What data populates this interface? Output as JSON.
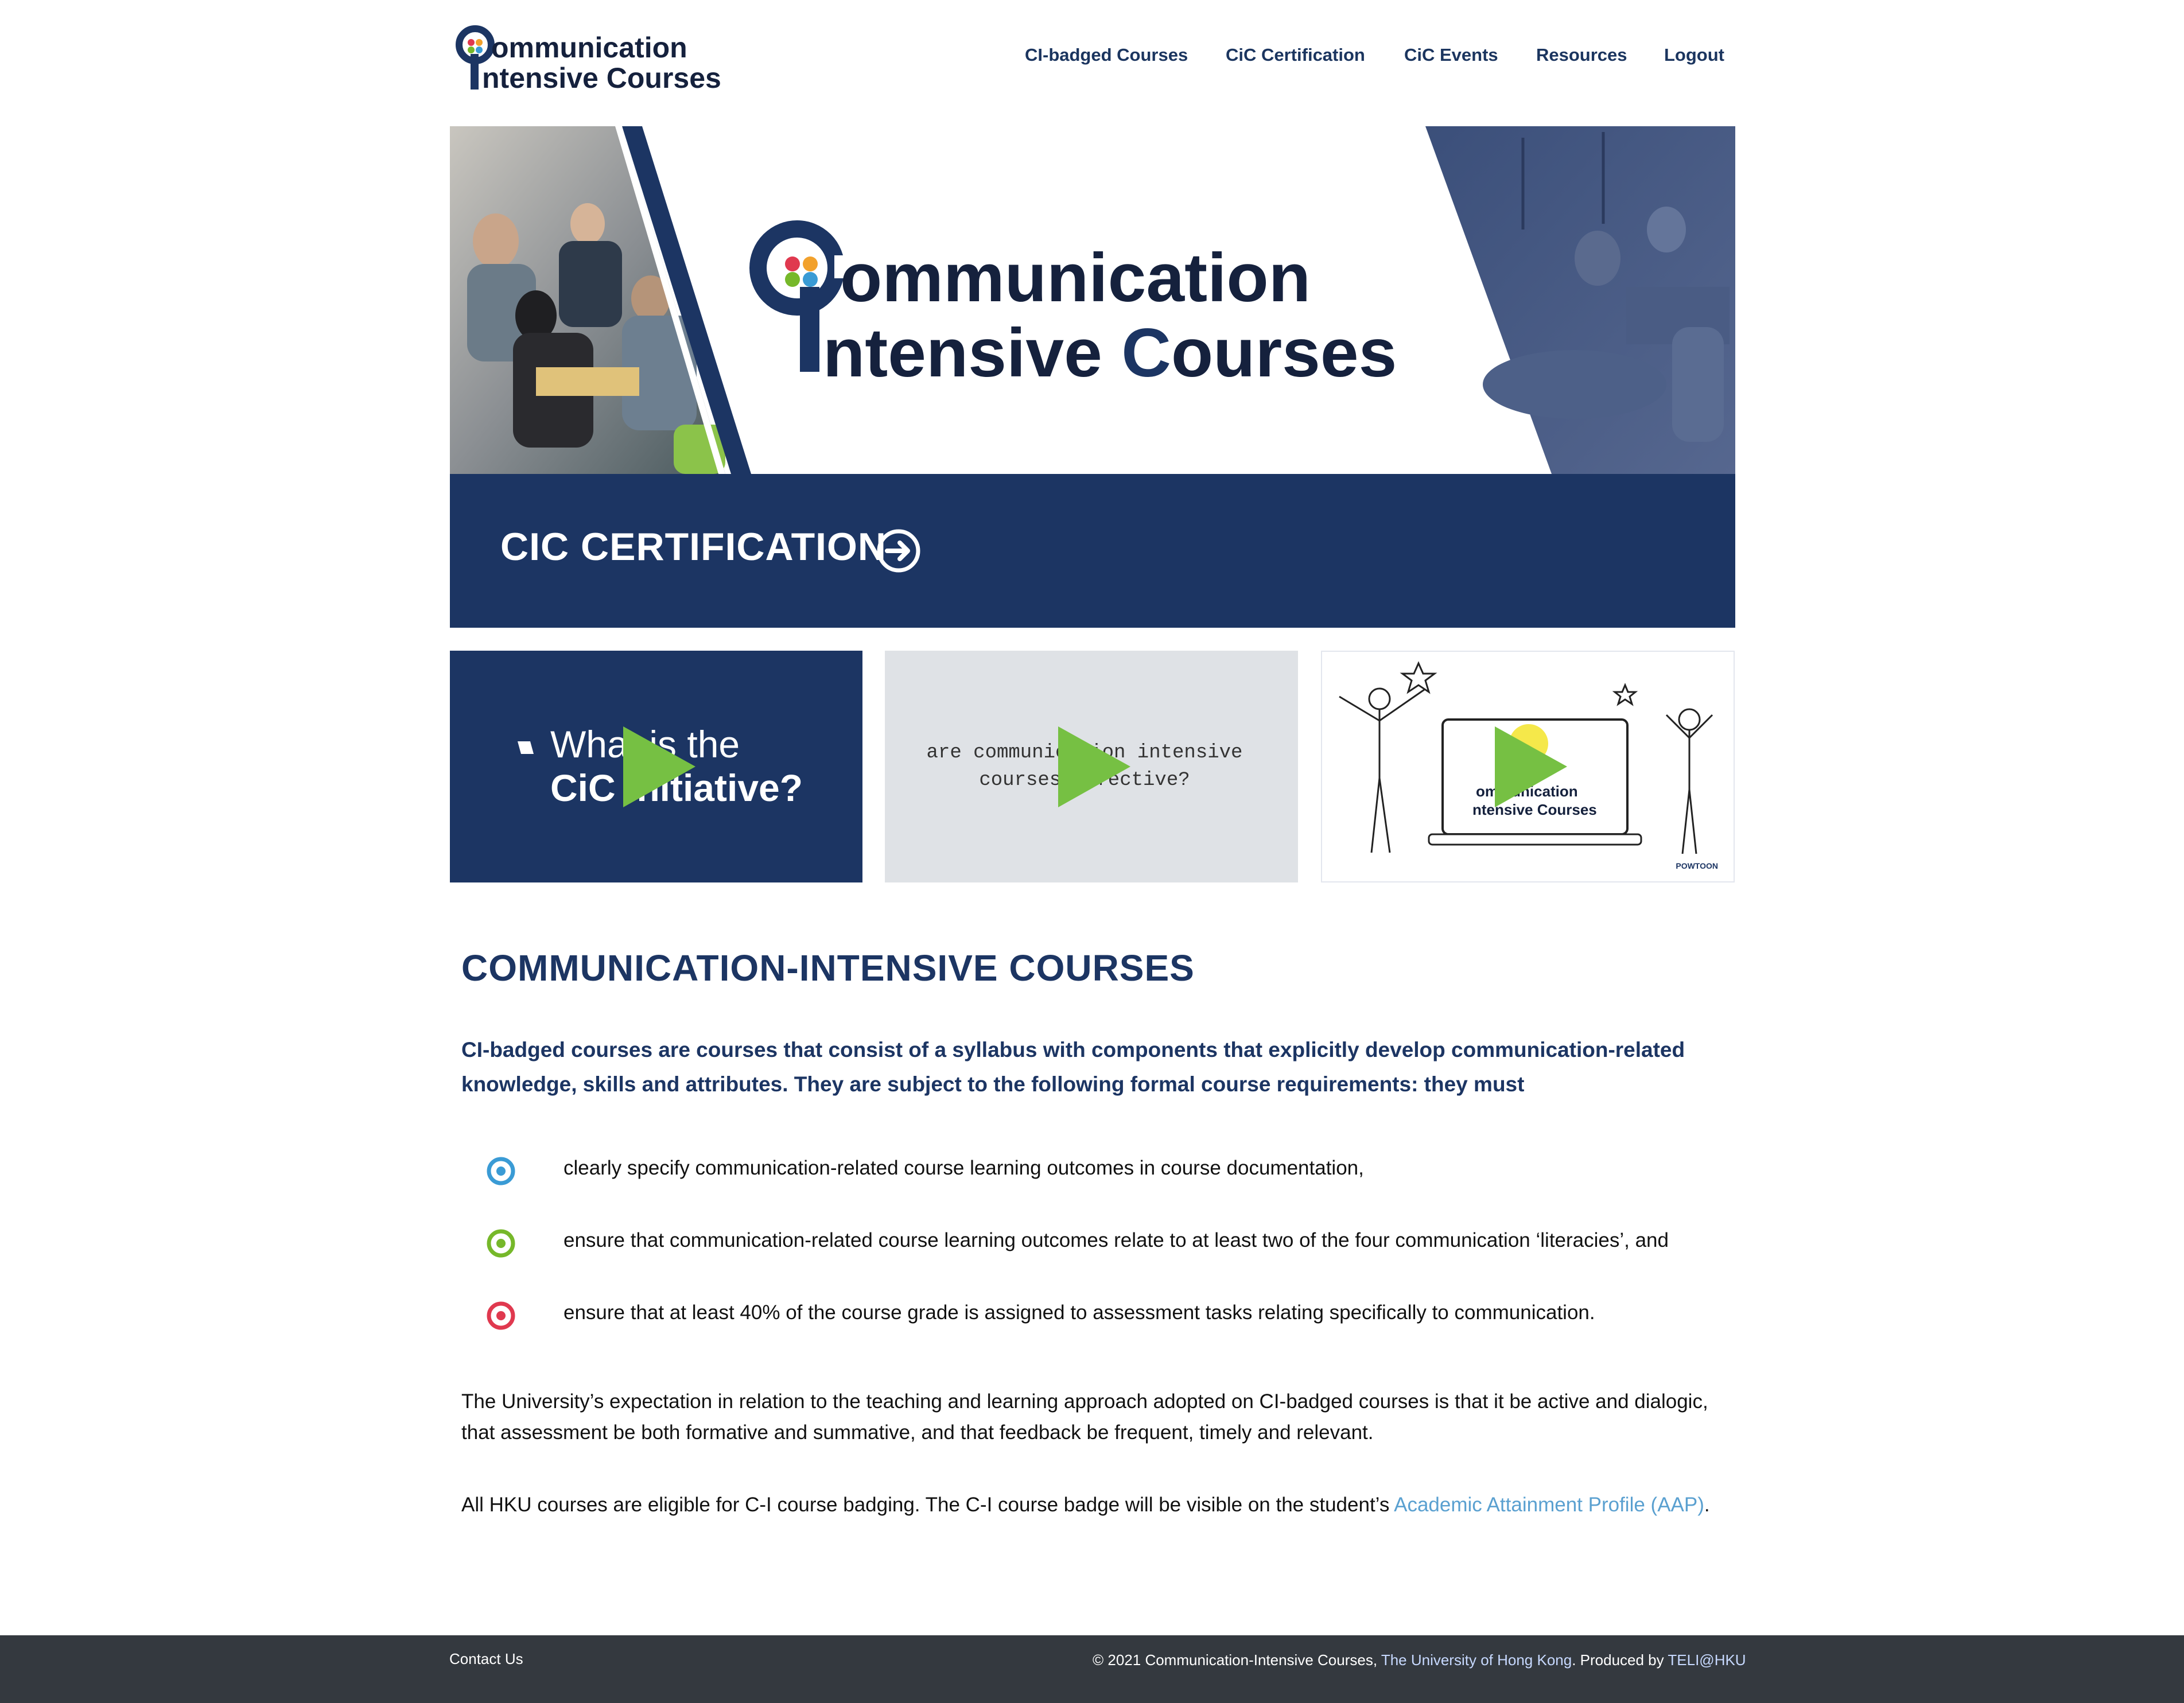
{
  "header": {
    "logo_text_line1": "ommunication",
    "logo_text_line2": "ntensive Courses",
    "nav": [
      {
        "label": "CI-badged Courses"
      },
      {
        "label": "CiC Certification"
      },
      {
        "label": "CiC Events"
      },
      {
        "label": "Resources"
      },
      {
        "label": "Logout"
      }
    ]
  },
  "hero": {
    "logo_line1": "ommunication",
    "logo_line2_a": "ntensive ",
    "logo_line2_b": "C",
    "logo_line2_c": "ourses"
  },
  "certification_banner": {
    "label": "CIC CERTIFICATION"
  },
  "videos": [
    {
      "line1": "What is the",
      "line2": "CiC Initiative?"
    },
    {
      "line1": "are communication intensive",
      "line2": "courses effective?"
    },
    {
      "laptop_line1": "ommunication",
      "laptop_line2": "ntensive Courses",
      "watermark": "POWTOON"
    }
  ],
  "content": {
    "title": "COMMUNICATION-INTENSIVE COURSES",
    "intro": "CI-badged courses are courses that consist of a syllabus with components that explicitly develop communication-related knowledge, skills and attributes.  They are subject to the following formal course requirements: they must",
    "requirements": [
      "clearly specify communication-related course learning outcomes in course documentation,",
      "ensure that communication-related course learning outcomes relate to at least two of the four communication ‘literacies’, and",
      "ensure that at least 40% of the course grade is assigned to assessment tasks relating specifically to communication."
    ],
    "paragraph1": "The University’s expectation in relation to the teaching and learning approach adopted on CI-badged courses is that it be active and dialogic, that assessment be both formative and summative, and that feedback be frequent, timely and relevant.",
    "paragraph2_text": "All HKU courses are eligible for C-I course badging. The C-I course badge will be visible on the student’s ",
    "paragraph2_link": "Academic Attainment Profile (AAP)",
    "paragraph2_end": "."
  },
  "footer": {
    "contact": "Contact Us",
    "copyright_prefix": "© 2021 Communication-Intensive Courses, ",
    "hku_link": "The University of Hong Kong",
    "produced_by": ". Produced by ",
    "teli_link": "TELI@HKU"
  },
  "colors": {
    "navy": "#1c3563",
    "accent_blue": "#3a9bd5",
    "accent_green": "#76b82a",
    "accent_red": "#e0394f",
    "link": "#5aa0d0",
    "footer": "#34393f"
  },
  "icons": [
    "logo-icon",
    "arrow-circle-icon",
    "play-icon",
    "target-bullet-icon"
  ]
}
